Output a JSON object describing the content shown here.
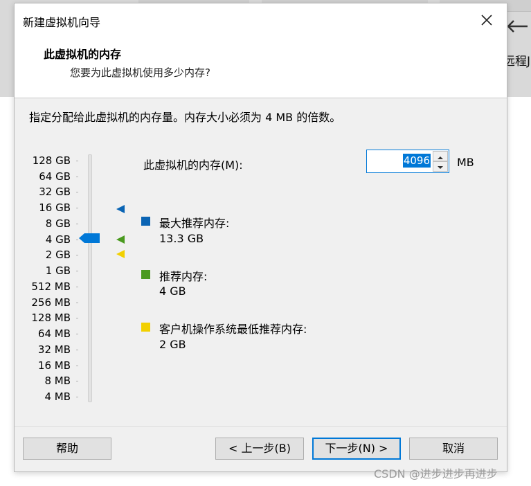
{
  "background": {
    "partial_label": "远程J"
  },
  "dialog": {
    "title": "新建虚拟机向导",
    "header_title": "此虚拟机的内存",
    "header_subtitle": "您要为此虚拟机使用多少内存?",
    "description": "指定分配给此虚拟机的内存量。内存大小必须为 4 MB 的倍数。"
  },
  "scale": {
    "labels": [
      "128 GB",
      "64 GB",
      "32 GB",
      "16 GB",
      "8 GB",
      "4 GB",
      "2 GB",
      "1 GB",
      "512 MB",
      "256 MB",
      "128 MB",
      "64 MB",
      "32 MB",
      "16 MB",
      "8 MB",
      "4 MB"
    ],
    "selected": "4 GB"
  },
  "memory": {
    "label": "此虚拟机的内存(M):",
    "value": "4096",
    "unit": "MB"
  },
  "legend": {
    "max": {
      "label": "最大推荐内存:",
      "value": "13.3 GB",
      "color": "#0a64b4"
    },
    "recommended": {
      "label": "推荐内存:",
      "value": "4 GB",
      "color": "#4a9a1f"
    },
    "guest_min": {
      "label": "客户机操作系统最低推荐内存:",
      "value": "2 GB",
      "color": "#f2d000"
    }
  },
  "buttons": {
    "help": "帮助",
    "back": "< 上一步(B)",
    "next": "下一步(N) >",
    "cancel": "取消"
  },
  "watermark": "CSDN @进步进步再进步",
  "icons": [
    "close-icon",
    "spin-up-icon",
    "spin-down-icon",
    "slider-thumb-icon",
    "max-marker-icon",
    "recommended-marker-icon",
    "guest-min-marker-icon"
  ]
}
